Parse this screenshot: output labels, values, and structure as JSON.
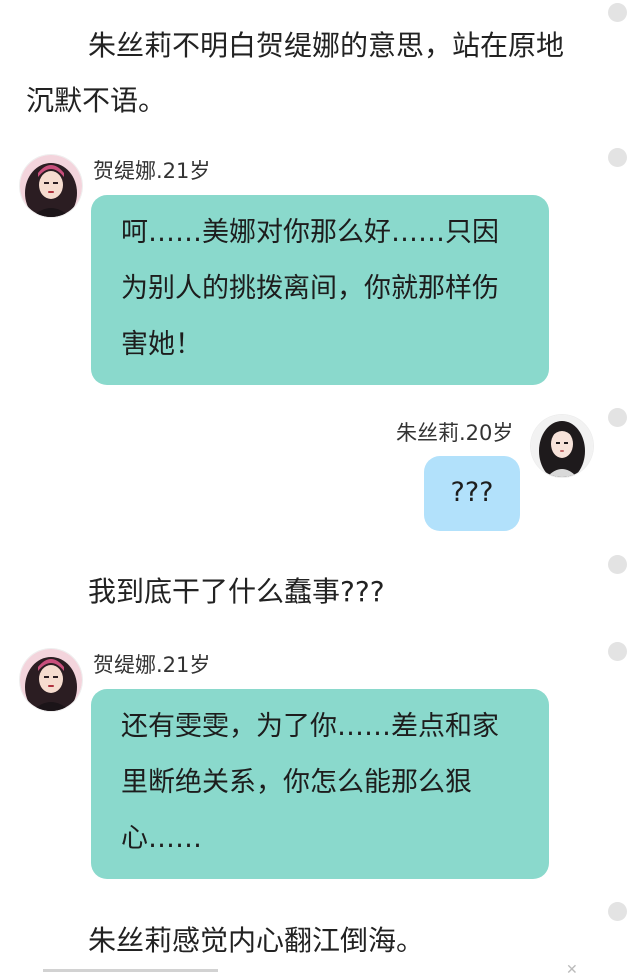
{
  "story": {
    "paragraphs": [
      "朱丝莉不明白贺缇娜的意思，站在原地沉默不语。",
      "我到底干了什么蠢事???",
      "朱丝莉感觉内心翻江倒海。"
    ]
  },
  "chat": [
    {
      "speaker": "贺缇娜.21岁",
      "side": "left",
      "text": "呵……美娜对你那么好……只因为别人的挑拨离间，你就那样伤害她！",
      "bubble_color": "#8ad9cc",
      "avatar": "girl-pink-hair-avatar"
    },
    {
      "speaker": "朱丝莉.20岁",
      "side": "right",
      "text": "???",
      "bubble_color": "#b2e1fb",
      "avatar": "girl-dark-hair-avatar"
    },
    {
      "speaker": "贺缇娜.21岁",
      "side": "left",
      "text": "还有雯雯，为了你……差点和家里断绝关系，你怎么能那么狠心……",
      "bubble_color": "#8ad9cc",
      "avatar": "girl-pink-hair-avatar"
    }
  ],
  "colors": {
    "teal_bubble": "#8ad9cc",
    "blue_bubble": "#b2e1fb",
    "side_dot": "#e3e3e3"
  }
}
